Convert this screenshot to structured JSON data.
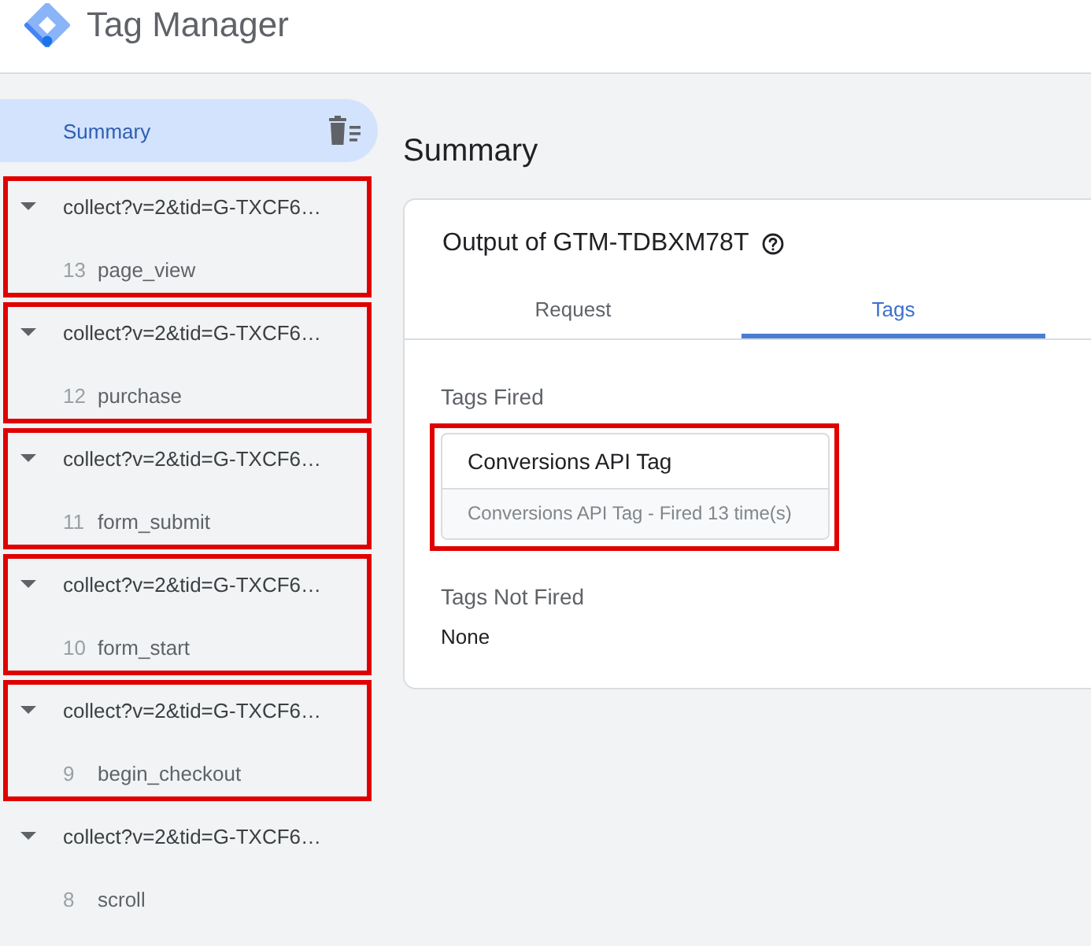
{
  "header": {
    "title": "Tag Manager"
  },
  "sidebar": {
    "summary": {
      "label": "Summary",
      "selected": true
    },
    "events": [
      {
        "url": "collect?v=2&tid=G-TXCF6…",
        "number": "13",
        "name": "page_view",
        "expanded": true,
        "highlighted": true
      },
      {
        "url": "collect?v=2&tid=G-TXCF6…",
        "number": "12",
        "name": "purchase",
        "expanded": true,
        "highlighted": true
      },
      {
        "url": "collect?v=2&tid=G-TXCF6…",
        "number": "11",
        "name": "form_submit",
        "expanded": true,
        "highlighted": true
      },
      {
        "url": "collect?v=2&tid=G-TXCF6…",
        "number": "10",
        "name": "form_start",
        "expanded": true,
        "highlighted": true
      },
      {
        "url": "collect?v=2&tid=G-TXCF6…",
        "number": "9",
        "name": "begin_checkout",
        "expanded": true,
        "highlighted": true
      },
      {
        "url": "collect?v=2&tid=G-TXCF6…",
        "number": "8",
        "name": "scroll",
        "expanded": true,
        "highlighted": false
      }
    ]
  },
  "main": {
    "heading": "Summary",
    "output": {
      "title": "Output of GTM-TDBXM78T",
      "tabs": [
        {
          "label": "Request",
          "selected": false
        },
        {
          "label": "Tags",
          "selected": true
        }
      ],
      "tags_fired": {
        "title": "Tags Fired",
        "tags": [
          {
            "name": "Conversions API Tag",
            "detail": "Conversions API Tag - Fired 13 time(s)",
            "highlighted": true
          }
        ]
      },
      "tags_not_fired": {
        "title": "Tags Not Fired",
        "value": "None"
      }
    }
  }
}
